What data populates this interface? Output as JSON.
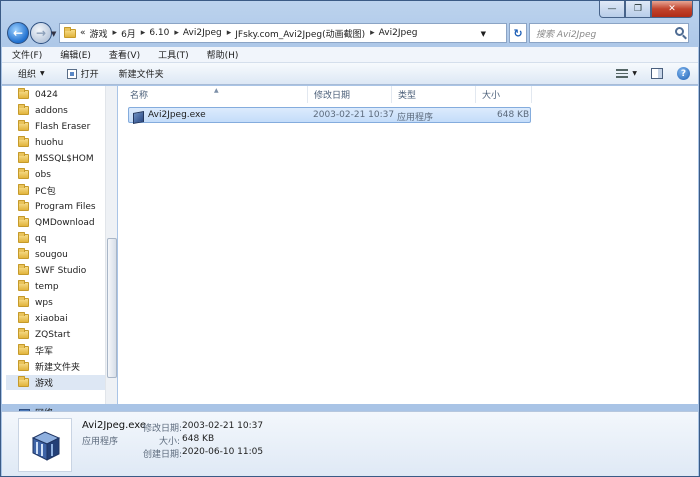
{
  "window": {
    "min_label": "—",
    "max_label": "❐",
    "close_label": "✕"
  },
  "address": {
    "prefix": "«",
    "crumbs": [
      "游戏",
      "6月",
      "6.10",
      "Avi2Jpeg",
      "JFsky.com_Avi2Jpeg(动画截图)",
      "Avi2Jpeg"
    ],
    "separator": "▸"
  },
  "search": {
    "placeholder": "搜索 Avi2Jpeg"
  },
  "menu": [
    "文件(F)",
    "编辑(E)",
    "查看(V)",
    "工具(T)",
    "帮助(H)"
  ],
  "toolbar": {
    "organize": "组织",
    "open": "打开",
    "new_folder": "新建文件夹"
  },
  "nav": {
    "folders": [
      "0424",
      "addons",
      "Flash Eraser",
      "huohu",
      "MSSQL$HOM",
      "obs",
      "PC包",
      "Program Files",
      "QMDownload",
      "qq",
      "sougou",
      "SWF Studio",
      "temp",
      "wps",
      "xiaobai",
      "ZQStart",
      "华军",
      "新建文件夹",
      "游戏"
    ],
    "selected": "游戏",
    "network": "网络"
  },
  "columns": {
    "name": "名称",
    "modified": "修改日期",
    "type": "类型",
    "size": "大小"
  },
  "files": [
    {
      "name": "Avi2Jpeg.exe",
      "modified": "2003-02-21 10:37",
      "type": "应用程序",
      "size": "648 KB"
    }
  ],
  "details": {
    "filename": "Avi2Jpeg.exe",
    "filetype": "应用程序",
    "modified_label": "修改日期:",
    "modified_value": "2003-02-21 10:37",
    "size_label": "大小:",
    "size_value": "648 KB",
    "created_label": "创建日期:",
    "created_value": "2020-06-10 11:05"
  },
  "icons": {
    "back": "back-arrow-icon",
    "forward": "forward-arrow-icon",
    "refresh": "refresh-icon",
    "search": "search-icon",
    "folder": "folder-icon",
    "exe": "application-icon",
    "help": "help-icon"
  }
}
